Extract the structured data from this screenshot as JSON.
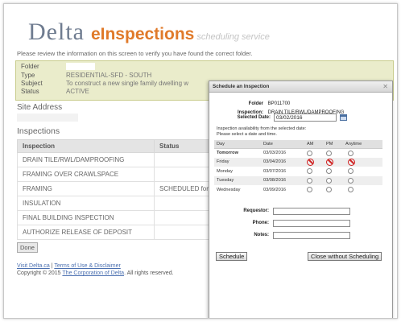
{
  "header": {
    "logo_delta": "Delta",
    "logo_einspections": "eInspections",
    "logo_tagline": "scheduling service"
  },
  "intro": "Please review the information on this screen to verify you have found the correct folder.",
  "folder_info": {
    "folder_label": "Folder",
    "folder_value": "",
    "type_label": "Type",
    "type_value": "RESIDENTIAL-SFD - SOUTH",
    "subject_label": "Subject",
    "subject_value": "To construct a new single family dwelling w",
    "status_label": "Status",
    "status_value": "ACTIVE"
  },
  "site_address_heading": "Site Address",
  "inspections": {
    "heading": "Inspections",
    "columns": [
      "Inspection",
      "Status"
    ],
    "rows": [
      {
        "inspection": "DRAIN TILE/RWL/DAMPROOFING",
        "status": ""
      },
      {
        "inspection": "FRAMING OVER CRAWLSPACE",
        "status": ""
      },
      {
        "inspection": "FRAMING",
        "status": "SCHEDULED for"
      },
      {
        "inspection": "INSULATION",
        "status": ""
      },
      {
        "inspection": "FINAL BUILDING INSPECTION",
        "status": ""
      },
      {
        "inspection": "AUTHORIZE RELEASE OF DEPOSIT",
        "status": ""
      }
    ]
  },
  "done_button": "Done",
  "footer": {
    "link1": "Visit Delta.ca",
    "sep": " | ",
    "link2": "Terms of Use & Disclaimer",
    "copyright_pre": "Copyright © 2015 ",
    "copyright_link": "The Corporation of Delta",
    "copyright_post": ". All rights reserved."
  },
  "modal": {
    "title": "Schedule an Inspection",
    "close_symbol": "✕",
    "folder_label": "Folder",
    "folder_value": "BP011700",
    "inspection_label": "Inspection:",
    "inspection_value": "DRAIN TILE/RWL/DAMPROOFING",
    "selected_date_label": "Selected Date:",
    "selected_date_value": "03/02/2016",
    "availability_line1": "Inspection availability from the selected date:",
    "availability_line2": "Please select a date and time.",
    "columns": [
      "Day",
      "Date",
      "AM",
      "PM",
      "Anytime"
    ],
    "rows": [
      {
        "day": "Tomorrow",
        "date": "03/03/2016",
        "am": "radio",
        "pm": "radio",
        "anytime": "radio",
        "bold": true
      },
      {
        "day": "Friday",
        "date": "03/04/2016",
        "am": "unavailable",
        "pm": "unavailable",
        "anytime": "unavailable",
        "bold": false
      },
      {
        "day": "Monday",
        "date": "03/07/2016",
        "am": "radio",
        "pm": "radio",
        "anytime": "radio",
        "bold": false
      },
      {
        "day": "Tuesday",
        "date": "03/08/2016",
        "am": "radio",
        "pm": "radio",
        "anytime": "radio",
        "bold": false
      },
      {
        "day": "Wednesday",
        "date": "03/09/2016",
        "am": "radio",
        "pm": "radio",
        "anytime": "radio",
        "bold": false
      }
    ],
    "requestor_label": "Requestor:",
    "phone_label": "Phone:",
    "notes_label": "Notes:",
    "schedule_button": "Schedule",
    "close_button": "Close without Scheduling"
  },
  "colors": {
    "logo_delta": "#6f7c90",
    "logo_orange": "#e07a2a",
    "info_bg": "#eaeccb",
    "unavailable_red": "#d02020",
    "link_blue": "#4a6fb0"
  }
}
